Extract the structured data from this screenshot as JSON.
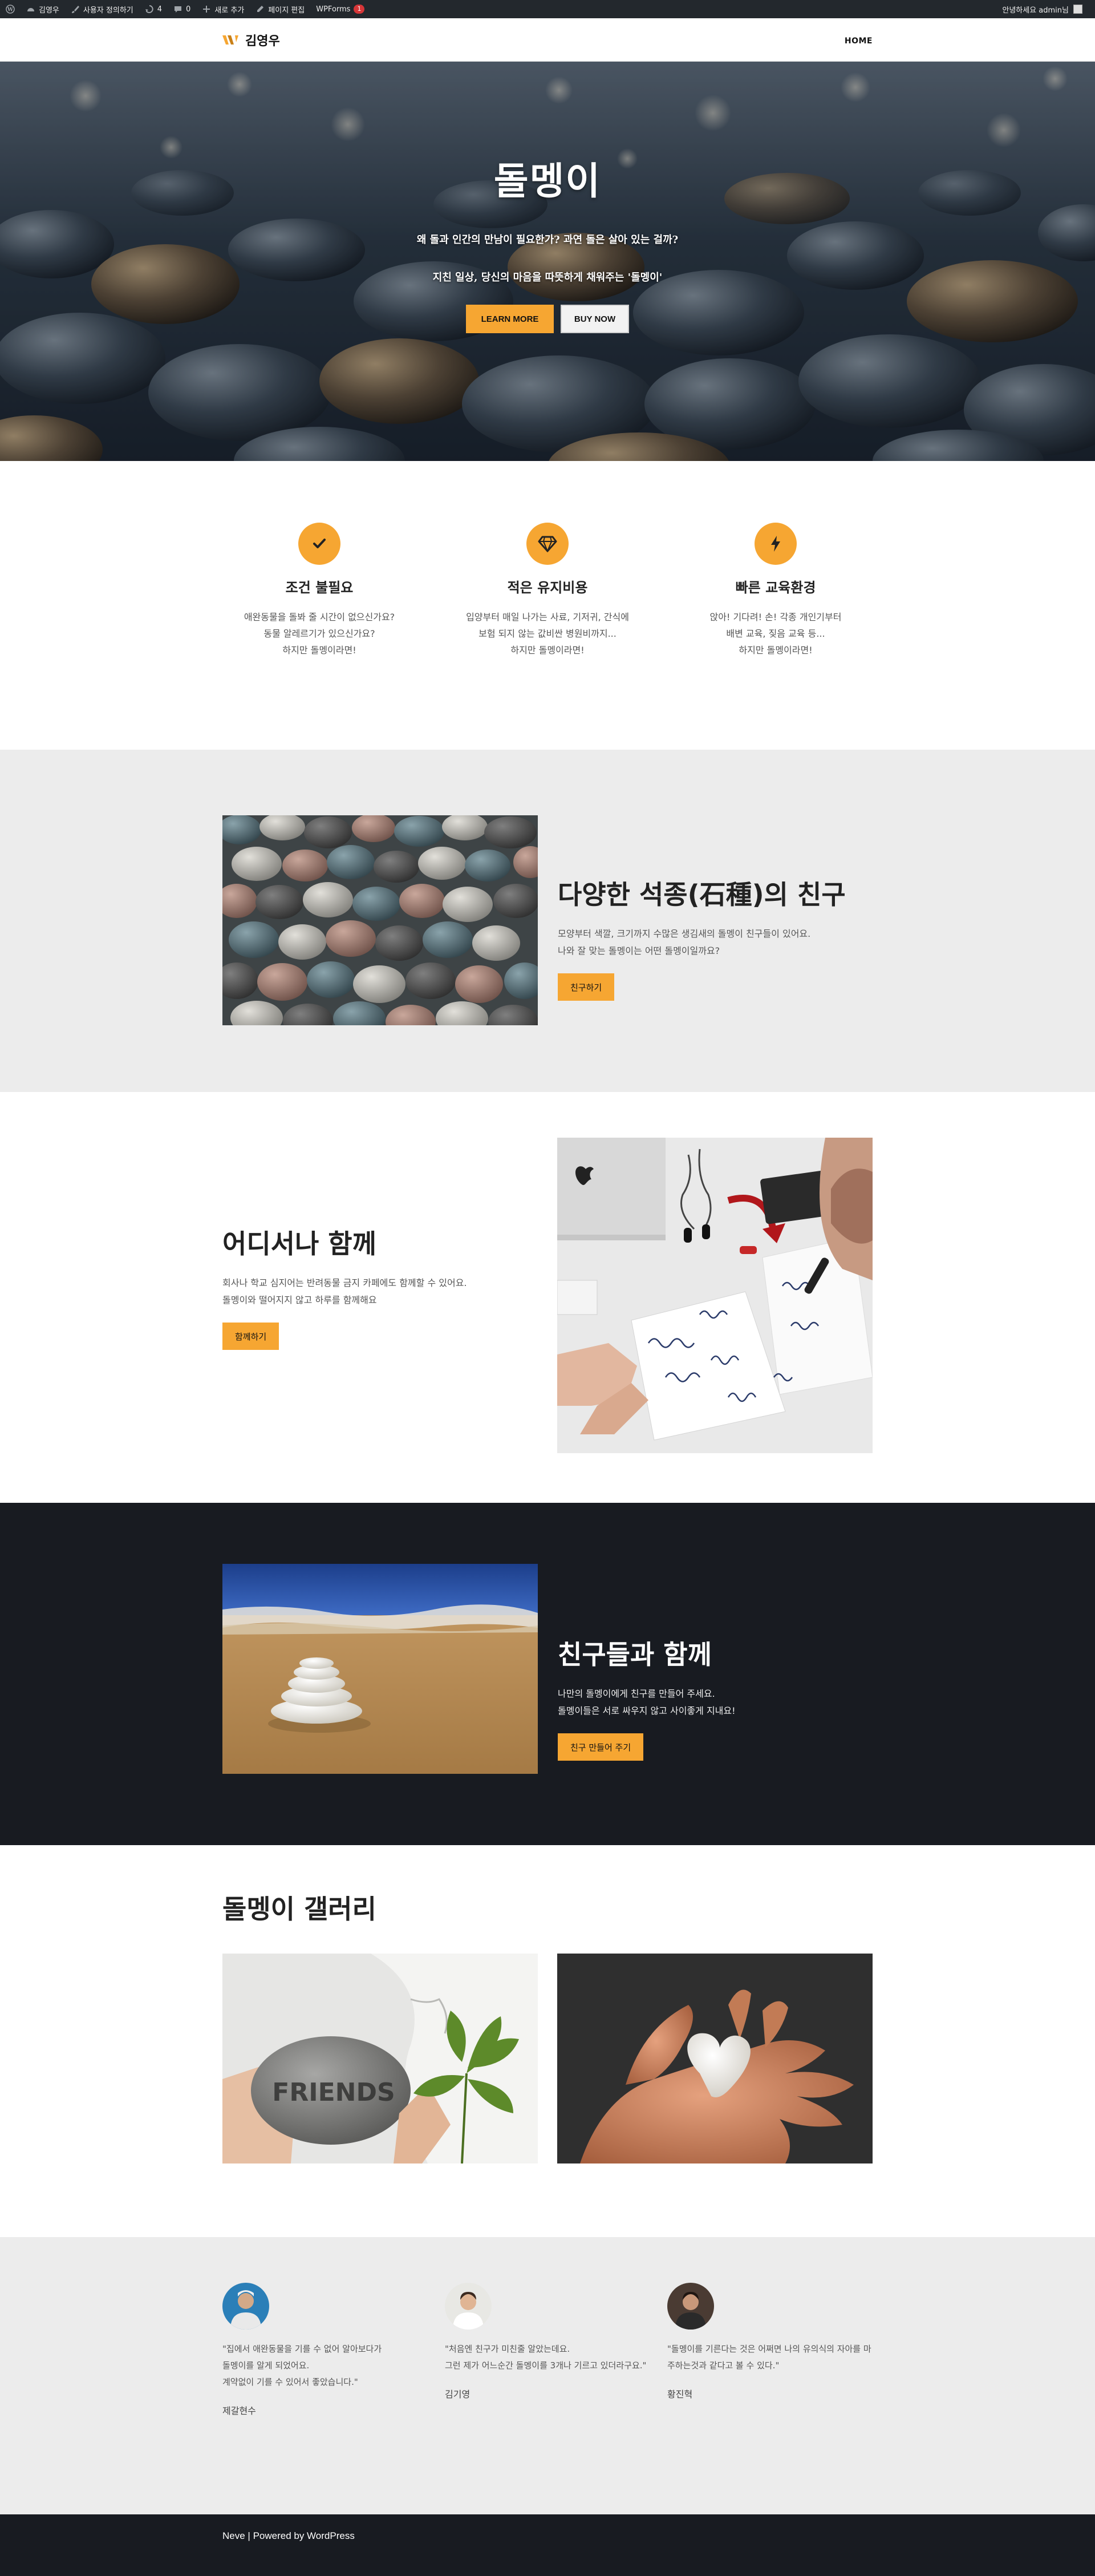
{
  "adminbar": {
    "site_name": "김영우",
    "customize": "사용자 정의하기",
    "updates_count": "4",
    "comments_count": "0",
    "new_content": "새로 추가",
    "edit_page": "페이지 편집",
    "wpforms": "WPForms",
    "wpforms_badge": "1",
    "greeting": "안녕하세요 admin님"
  },
  "header": {
    "site_title": "김영우",
    "nav_home": "HOME"
  },
  "hero": {
    "title": "돌멩이",
    "line1": "왜 돌과 인간의 만남이 필요한가? 과연 돌은 살아 있는 걸까?",
    "line2": "지친 일상, 당신의 마음을 따뜻하게 채워주는 '돌멩이'",
    "button_primary": "LEARN MORE",
    "button_secondary": "BUY NOW"
  },
  "features": [
    {
      "icon": "check-icon",
      "title": "조건 불필요",
      "lines": [
        "애완동물을 돌봐 줄 시간이 없으신가요?",
        "동물 알레르기가 있으신가요?",
        "하지만 돌멩이라면!"
      ]
    },
    {
      "icon": "diamond-icon",
      "title": "적은 유지비용",
      "lines": [
        "입양부터 매일 나가는 사료, 기저귀, 간식에",
        "보험 되지 않는 값비싼 병원비까지...",
        "하지만 돌멩이라면!"
      ]
    },
    {
      "icon": "bolt-icon",
      "title": "빠른 교육환경",
      "lines": [
        "앉아! 기다려! 손! 각종 개인기부터",
        "배변 교육, 짖음 교육 등...",
        "하지만 돌멩이라면!"
      ]
    }
  ],
  "section_variety": {
    "title": "다양한 석종(石種)의 친구",
    "desc": [
      "모양부터 색깔, 크기까지 수많은 생김새의 돌멩이 친구들이 있어요.",
      "나와 잘 맞는 돌멩이는 어떤 돌멩이일까요?"
    ],
    "button": "친구하기"
  },
  "section_everywhere": {
    "title": "어디서나 함께",
    "desc": [
      "회사나 학교 심지어는 반려동물 금지 카페에도 함께할 수 있어요.",
      "돌멩이와 떨어지지 않고 하루를 함께해요"
    ],
    "button": "함께하기"
  },
  "section_friends": {
    "title": "친구들과 함께",
    "desc": [
      "나만의 돌멩이에게 친구를 만들어 주세요.",
      "돌멩이들은 서로 싸우지 않고 사이좋게 지내요!"
    ],
    "button": "친구 만들어 주기"
  },
  "gallery": {
    "title": "돌멩이 갤러리",
    "friends_text": "FRIENDS"
  },
  "testimonials": [
    {
      "quote": [
        "\"집에서 애완동물을 기를 수 없어 알아보다가",
        "돌멩이를 알게 되었어요.",
        "계약없이 기를 수 있어서 좋았습니다.\""
      ],
      "author": "제갈현수"
    },
    {
      "quote": [
        "\"처음엔 친구가 미친줄 알았는데요.",
        "그런 제가 어느순간 돌멩이를 3개나 기르고 있더라구요.\""
      ],
      "author": "김기영"
    },
    {
      "quote": [
        "\"돌멩이를 기른다는 것은 어쩌면 나의 유의식의 자아를 마",
        "주하는것과 같다고 볼 수 있다.\""
      ],
      "author": "황진혁"
    }
  ],
  "footer": {
    "theme": "Neve",
    "separator": " | ",
    "powered": "Powered by WordPress"
  },
  "colors": {
    "accent": "#f6a632",
    "dark": "#181b21",
    "gray_bg": "#ececec",
    "adminbar": "#23282d"
  }
}
